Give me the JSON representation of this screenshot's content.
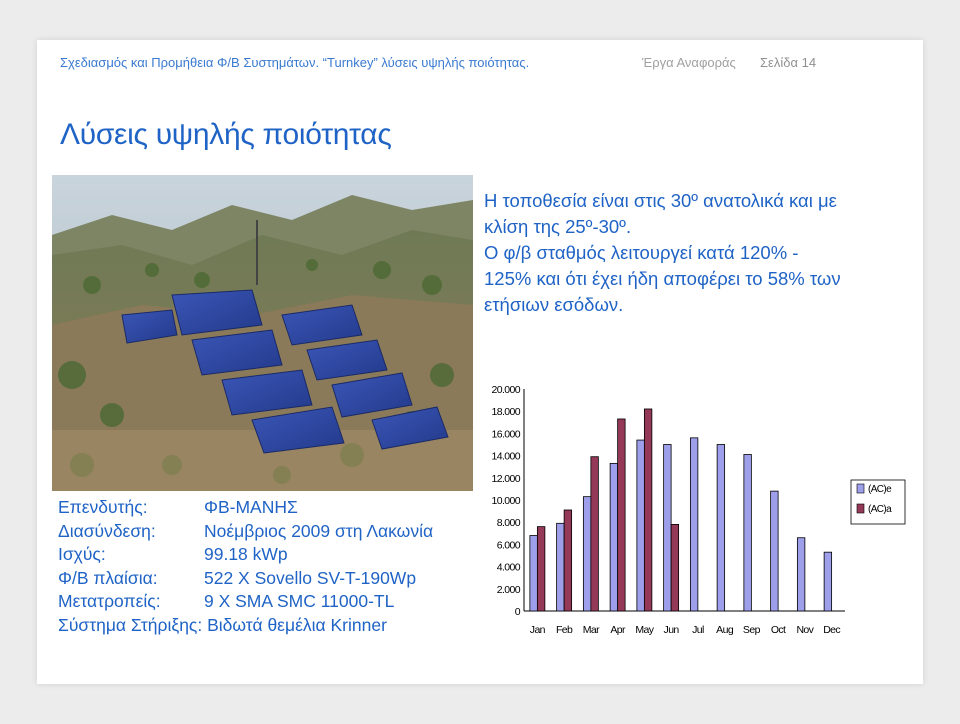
{
  "header": {
    "left": "Σχεδιασμός και Προμήθεια Φ/Β Συστημάτων. “Turnkey” λύσεις υψηλής ποιότητας.",
    "middle": "Έργα Αναφοράς",
    "right": "Σελίδα 14"
  },
  "title": "Λύσεις υψηλής ποιότητας",
  "description": [
    "Η τοποθεσία είναι στις 30º ανατολικά και με",
    "κλίση της 25º-30º.",
    "Ο φ/β σταθμός λειτουργεί κατά 120% -",
    "125% και ότι έχει ήδη αποφέρει το 58% των",
    "ετήσιων εσόδων."
  ],
  "info": [
    {
      "label": "Επενδυτής:",
      "value": "ΦΒ-ΜΑΝΗΣ"
    },
    {
      "label": "Διασύνδεση:",
      "value": "Νοέμβριος 2009 στη Λακωνία"
    },
    {
      "label": "Ισχύς:",
      "value": "99.18 kWp"
    },
    {
      "label": "Φ/Β πλαίσια:",
      "value": "522 X Sovello SV-T-190Wp"
    },
    {
      "label": "Μετατροπείς:",
      "value": "9 X SMA SMC 11000-TL"
    }
  ],
  "info_last": "Σύστημα Στήριξης: Βιδωτά θεμέλια Krinner",
  "chart_data": {
    "type": "bar",
    "categories": [
      "Jan",
      "Feb",
      "Mar",
      "Apr",
      "May",
      "Jun",
      "Jul",
      "Aug",
      "Sep",
      "Oct",
      "Nov",
      "Dec"
    ],
    "series": [
      {
        "name": "(AC)e",
        "color": "#9e9fea",
        "values": [
          6800,
          7900,
          10300,
          13300,
          15400,
          15000,
          15600,
          15000,
          14100,
          10800,
          6600,
          5300
        ]
      },
      {
        "name": "(AC)a",
        "color": "#953959",
        "values": [
          7600,
          9100,
          13900,
          17300,
          18200,
          7800,
          null,
          null,
          null,
          null,
          null,
          null
        ]
      }
    ],
    "yticks": [
      "0",
      "2.000",
      "4.000",
      "6.000",
      "8.000",
      "10.000",
      "12.000",
      "14.000",
      "16.000",
      "18.000",
      "20.000"
    ],
    "ylim": [
      0,
      20000
    ],
    "legend": "right",
    "grid": false
  }
}
